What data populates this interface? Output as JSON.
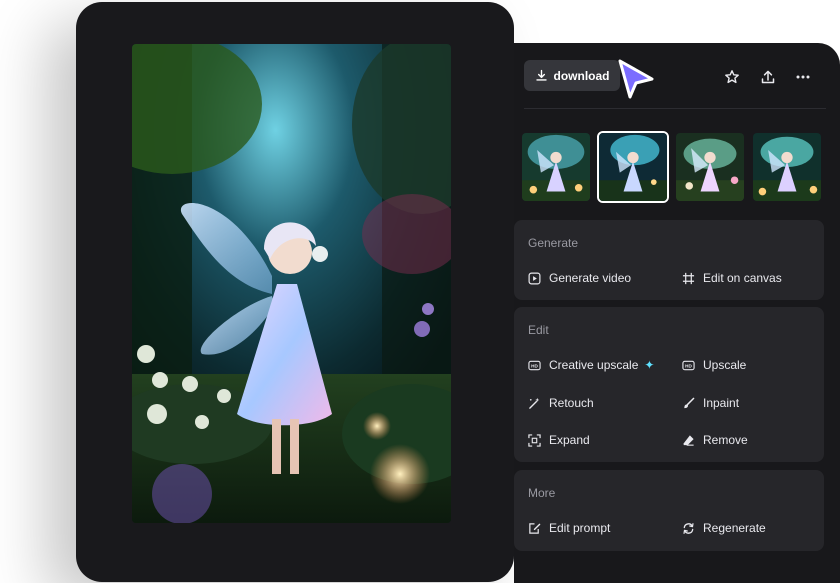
{
  "toolbar": {
    "download_label": "download",
    "icons": [
      "download-icon",
      "star-icon",
      "share-icon",
      "more-icon"
    ]
  },
  "thumbnails": {
    "count": 4,
    "selected_index": 1
  },
  "sections": {
    "generate": {
      "title": "Generate",
      "actions": [
        {
          "label": "Generate video",
          "icon": "play-icon"
        },
        {
          "label": "Edit on canvas",
          "icon": "canvas-icon"
        }
      ]
    },
    "edit": {
      "title": "Edit",
      "actions": [
        {
          "label": "Creative upscale",
          "icon": "hd-icon",
          "badge": "✦"
        },
        {
          "label": "Upscale",
          "icon": "hd-icon"
        },
        {
          "label": "Retouch",
          "icon": "magic-wand-icon"
        },
        {
          "label": "Inpaint",
          "icon": "brush-icon"
        },
        {
          "label": "Expand",
          "icon": "expand-icon"
        },
        {
          "label": "Remove",
          "icon": "eraser-icon"
        }
      ]
    },
    "more": {
      "title": "More",
      "actions": [
        {
          "label": "Edit prompt",
          "icon": "edit-prompt-icon"
        },
        {
          "label": "Regenerate",
          "icon": "regenerate-icon"
        }
      ]
    }
  },
  "colors": {
    "panel_bg": "#18181b",
    "section_bg": "#26262a",
    "button_bg": "#35363b",
    "cursor_accent": "#7b6cff",
    "sparkle": "#5fe1ff"
  }
}
